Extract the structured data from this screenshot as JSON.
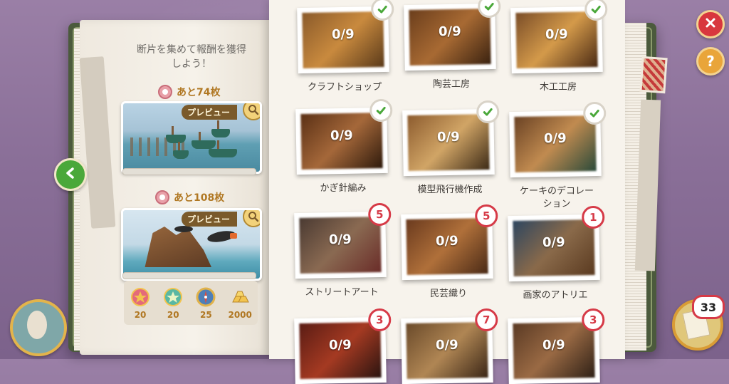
{
  "left_page": {
    "title": "断片を集めて報酬を獲得\nしよう！",
    "panels": [
      {
        "remaining": "あと74枚",
        "preview_label": "プレビュー"
      },
      {
        "remaining": "あと108枚",
        "preview_label": "プレビュー"
      }
    ],
    "rewards": [
      {
        "icon": "star-badge-red-icon",
        "value": "20"
      },
      {
        "icon": "star-badge-green-icon",
        "value": "20"
      },
      {
        "icon": "compass-icon",
        "value": "25"
      },
      {
        "icon": "gold-bars-icon",
        "value": "2000"
      }
    ]
  },
  "collections": [
    {
      "label": "クラフトショップ",
      "progress": "0/9",
      "status": "complete",
      "badge": ""
    },
    {
      "label": "陶芸工房",
      "progress": "0/9",
      "status": "complete",
      "badge": ""
    },
    {
      "label": "木工工房",
      "progress": "0/9",
      "status": "complete",
      "badge": ""
    },
    {
      "label": "かぎ針編み",
      "progress": "0/9",
      "status": "complete",
      "badge": ""
    },
    {
      "label": "模型飛行機作成",
      "progress": "0/9",
      "status": "complete",
      "badge": ""
    },
    {
      "label": "ケーキのデコレー\nション",
      "progress": "0/9",
      "status": "complete",
      "badge": ""
    },
    {
      "label": "ストリートアート",
      "progress": "0/9",
      "status": "count",
      "badge": "5"
    },
    {
      "label": "民芸織り",
      "progress": "0/9",
      "status": "count",
      "badge": "5"
    },
    {
      "label": "画家のアトリエ",
      "progress": "0/9",
      "status": "count",
      "badge": "1"
    },
    {
      "label": "",
      "progress": "0/9",
      "status": "count",
      "badge": "3"
    },
    {
      "label": "",
      "progress": "0/9",
      "status": "count",
      "badge": "7"
    },
    {
      "label": "",
      "progress": "0/9",
      "status": "count",
      "badge": "3"
    }
  ],
  "ui": {
    "close_icon": "close-icon",
    "help_label": "?",
    "back_icon": "chevron-left-icon",
    "stock_count": "33"
  },
  "colors": {
    "accent_gold": "#b07722",
    "badge_red": "#d63a47",
    "check_green": "#4aa83a"
  }
}
